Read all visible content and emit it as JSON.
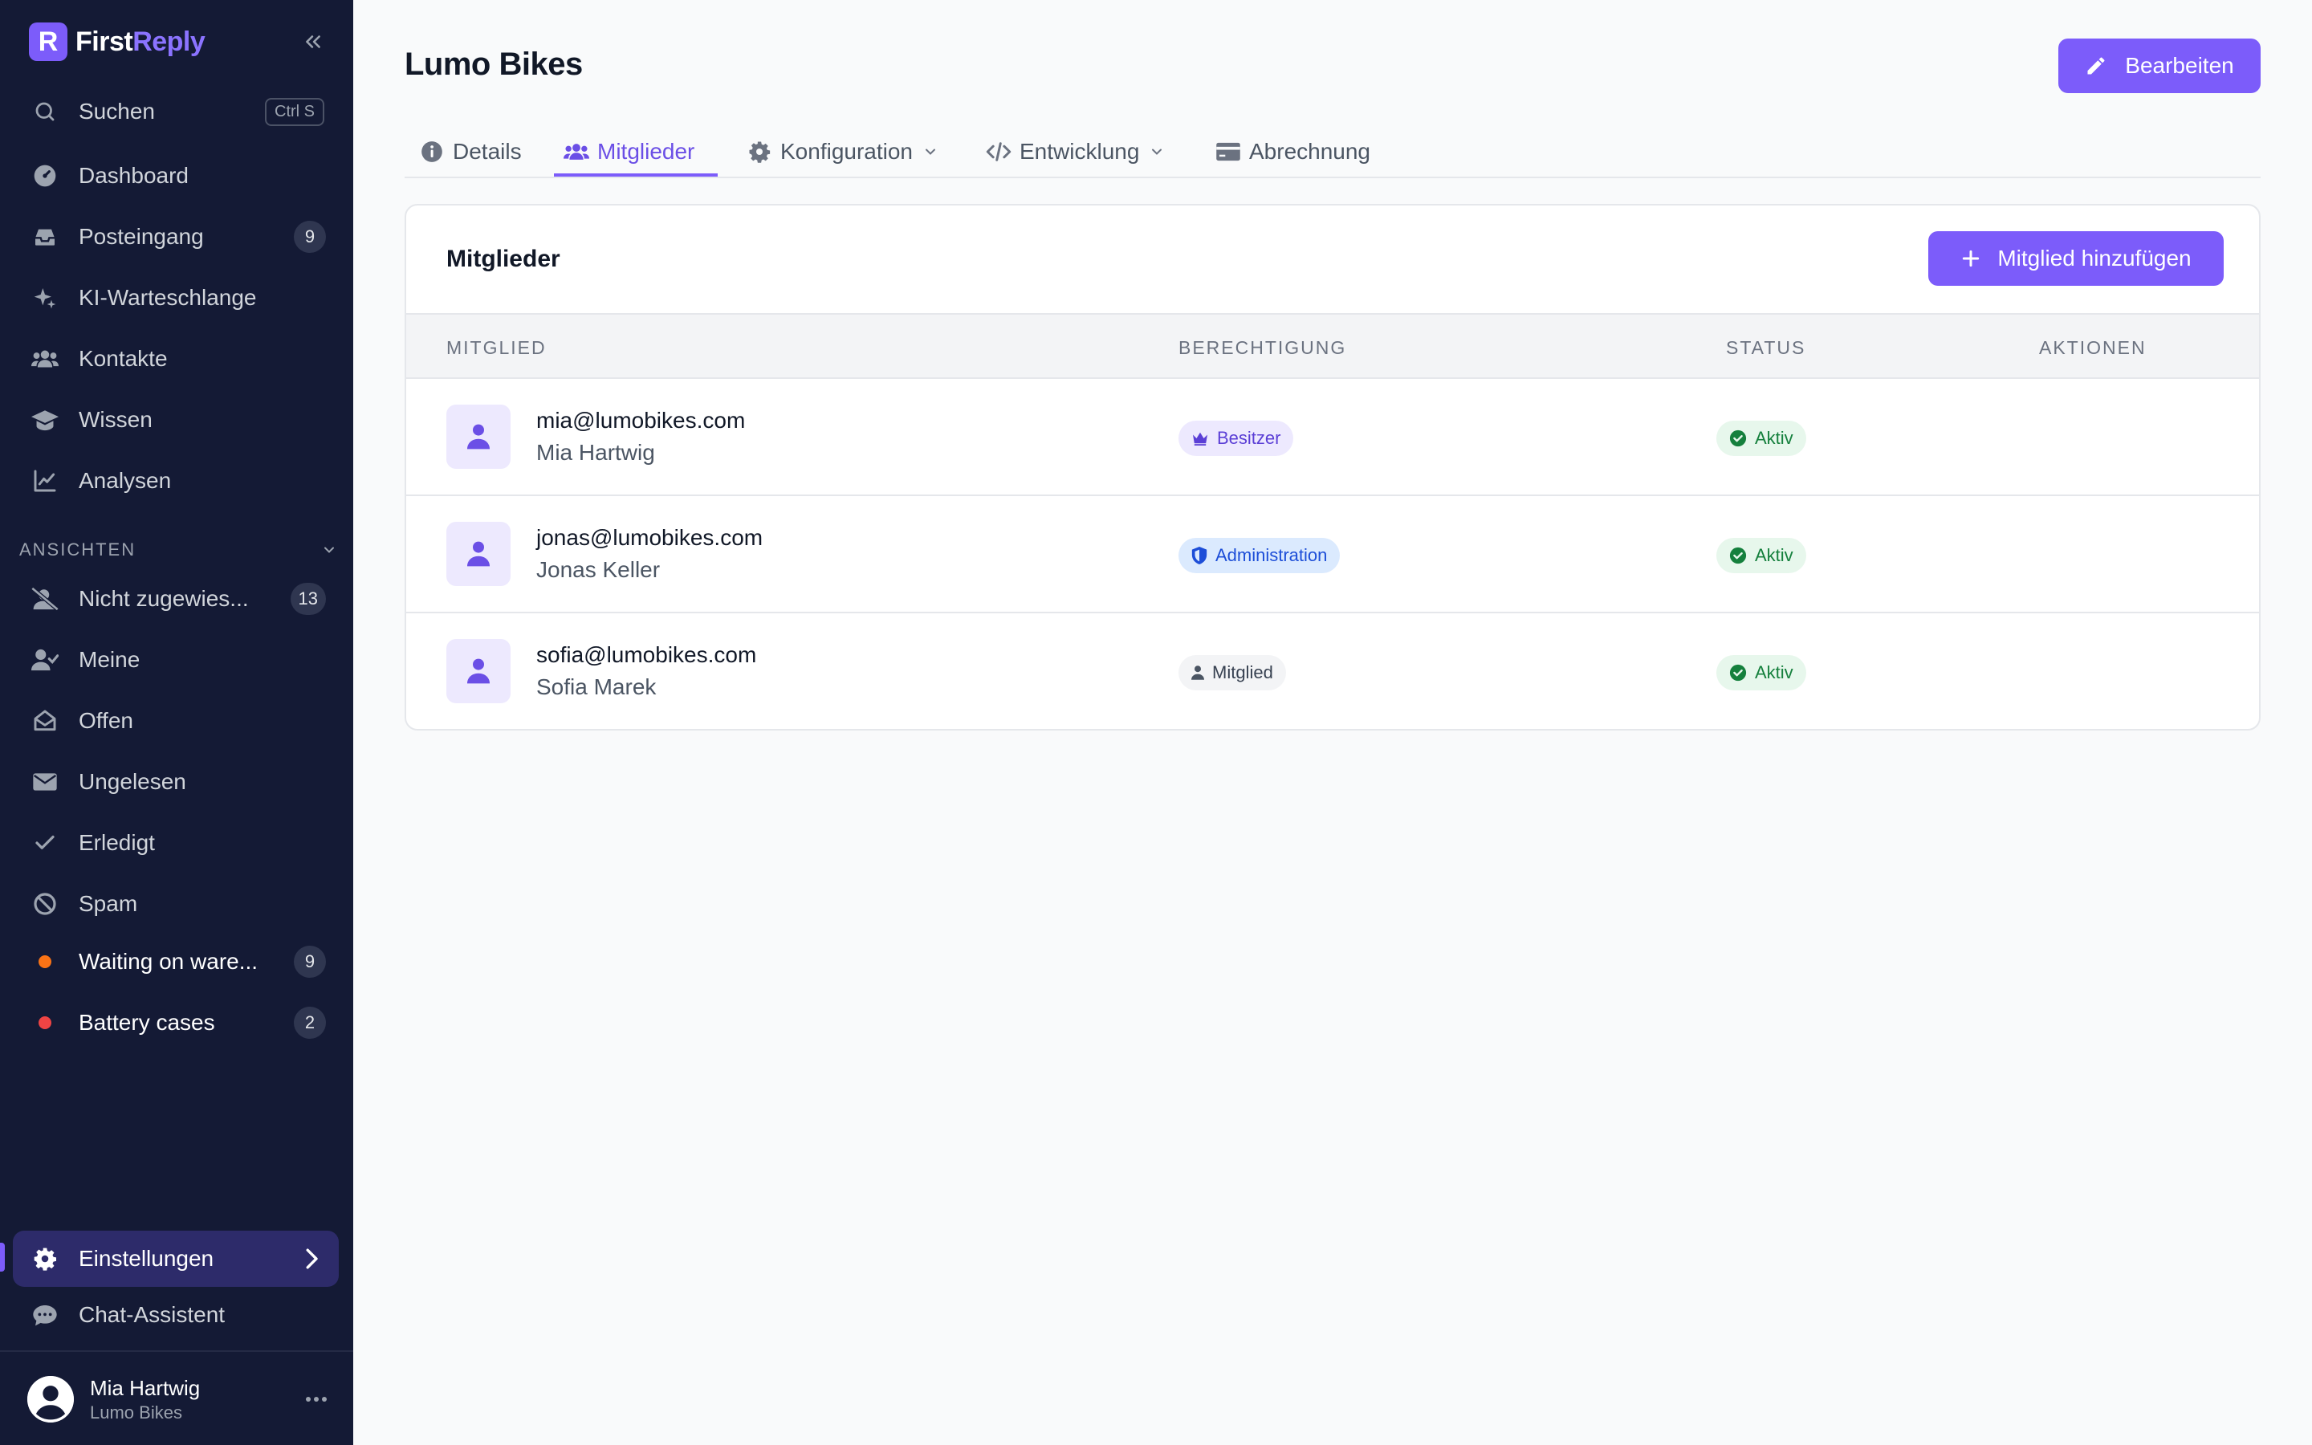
{
  "app": {
    "brand_first": "First",
    "brand_second": "Reply",
    "logo_letter": "R"
  },
  "sidebar": {
    "search": {
      "label": "Suchen",
      "shortcut": "Ctrl S"
    },
    "items": [
      {
        "label": "Dashboard",
        "icon": "gauge-icon"
      },
      {
        "label": "Posteingang",
        "icon": "inbox-icon",
        "badge": "9"
      },
      {
        "label": "KI-Warteschlange",
        "icon": "sparkles-icon"
      },
      {
        "label": "Kontakte",
        "icon": "users-icon"
      },
      {
        "label": "Wissen",
        "icon": "graduation-cap-icon"
      },
      {
        "label": "Analysen",
        "icon": "chart-line-icon"
      }
    ],
    "views_label": "ANSICHTEN",
    "views": [
      {
        "label": "Nicht zugewies...",
        "icon": "user-slash-icon",
        "badge": "13"
      },
      {
        "label": "Meine",
        "icon": "user-check-icon"
      },
      {
        "label": "Offen",
        "icon": "envelope-open-icon"
      },
      {
        "label": "Ungelesen",
        "icon": "envelope-icon"
      },
      {
        "label": "Erledigt",
        "icon": "check-icon"
      },
      {
        "label": "Spam",
        "icon": "ban-icon"
      },
      {
        "label": "Waiting on ware...",
        "color": "#f97316",
        "badge": "9"
      },
      {
        "label": "Battery cases",
        "color": "#ef4444",
        "badge": "2"
      }
    ],
    "settings_label": "Einstellungen",
    "chat_label": "Chat-Assistent",
    "user": {
      "name": "Mia Hartwig",
      "org": "Lumo Bikes"
    }
  },
  "main": {
    "title": "Lumo Bikes",
    "edit_label": "Bearbeiten",
    "tabs": [
      {
        "label": "Details"
      },
      {
        "label": "Mitglieder"
      },
      {
        "label": "Konfiguration"
      },
      {
        "label": "Entwicklung"
      },
      {
        "label": "Abrechnung"
      }
    ],
    "card": {
      "title": "Mitglieder",
      "add_label": "Mitglied hinzufügen",
      "columns": [
        "MITGLIED",
        "BERECHTIGUNG",
        "STATUS",
        "AKTIONEN"
      ],
      "rows": [
        {
          "email": "mia@lumobikes.com",
          "name": "Mia Hartwig",
          "role": "Besitzer",
          "status": "Aktiv"
        },
        {
          "email": "jonas@lumobikes.com",
          "name": "Jonas Keller",
          "role": "Administration",
          "status": "Aktiv"
        },
        {
          "email": "sofia@lumobikes.com",
          "name": "Sofia Marek",
          "role": "Mitglied",
          "status": "Aktiv"
        }
      ]
    }
  },
  "colors": {
    "accent": "#7c5cfa",
    "sidebar_bg": "#141a35",
    "danger": "#dc2626",
    "success": "#15803d"
  }
}
